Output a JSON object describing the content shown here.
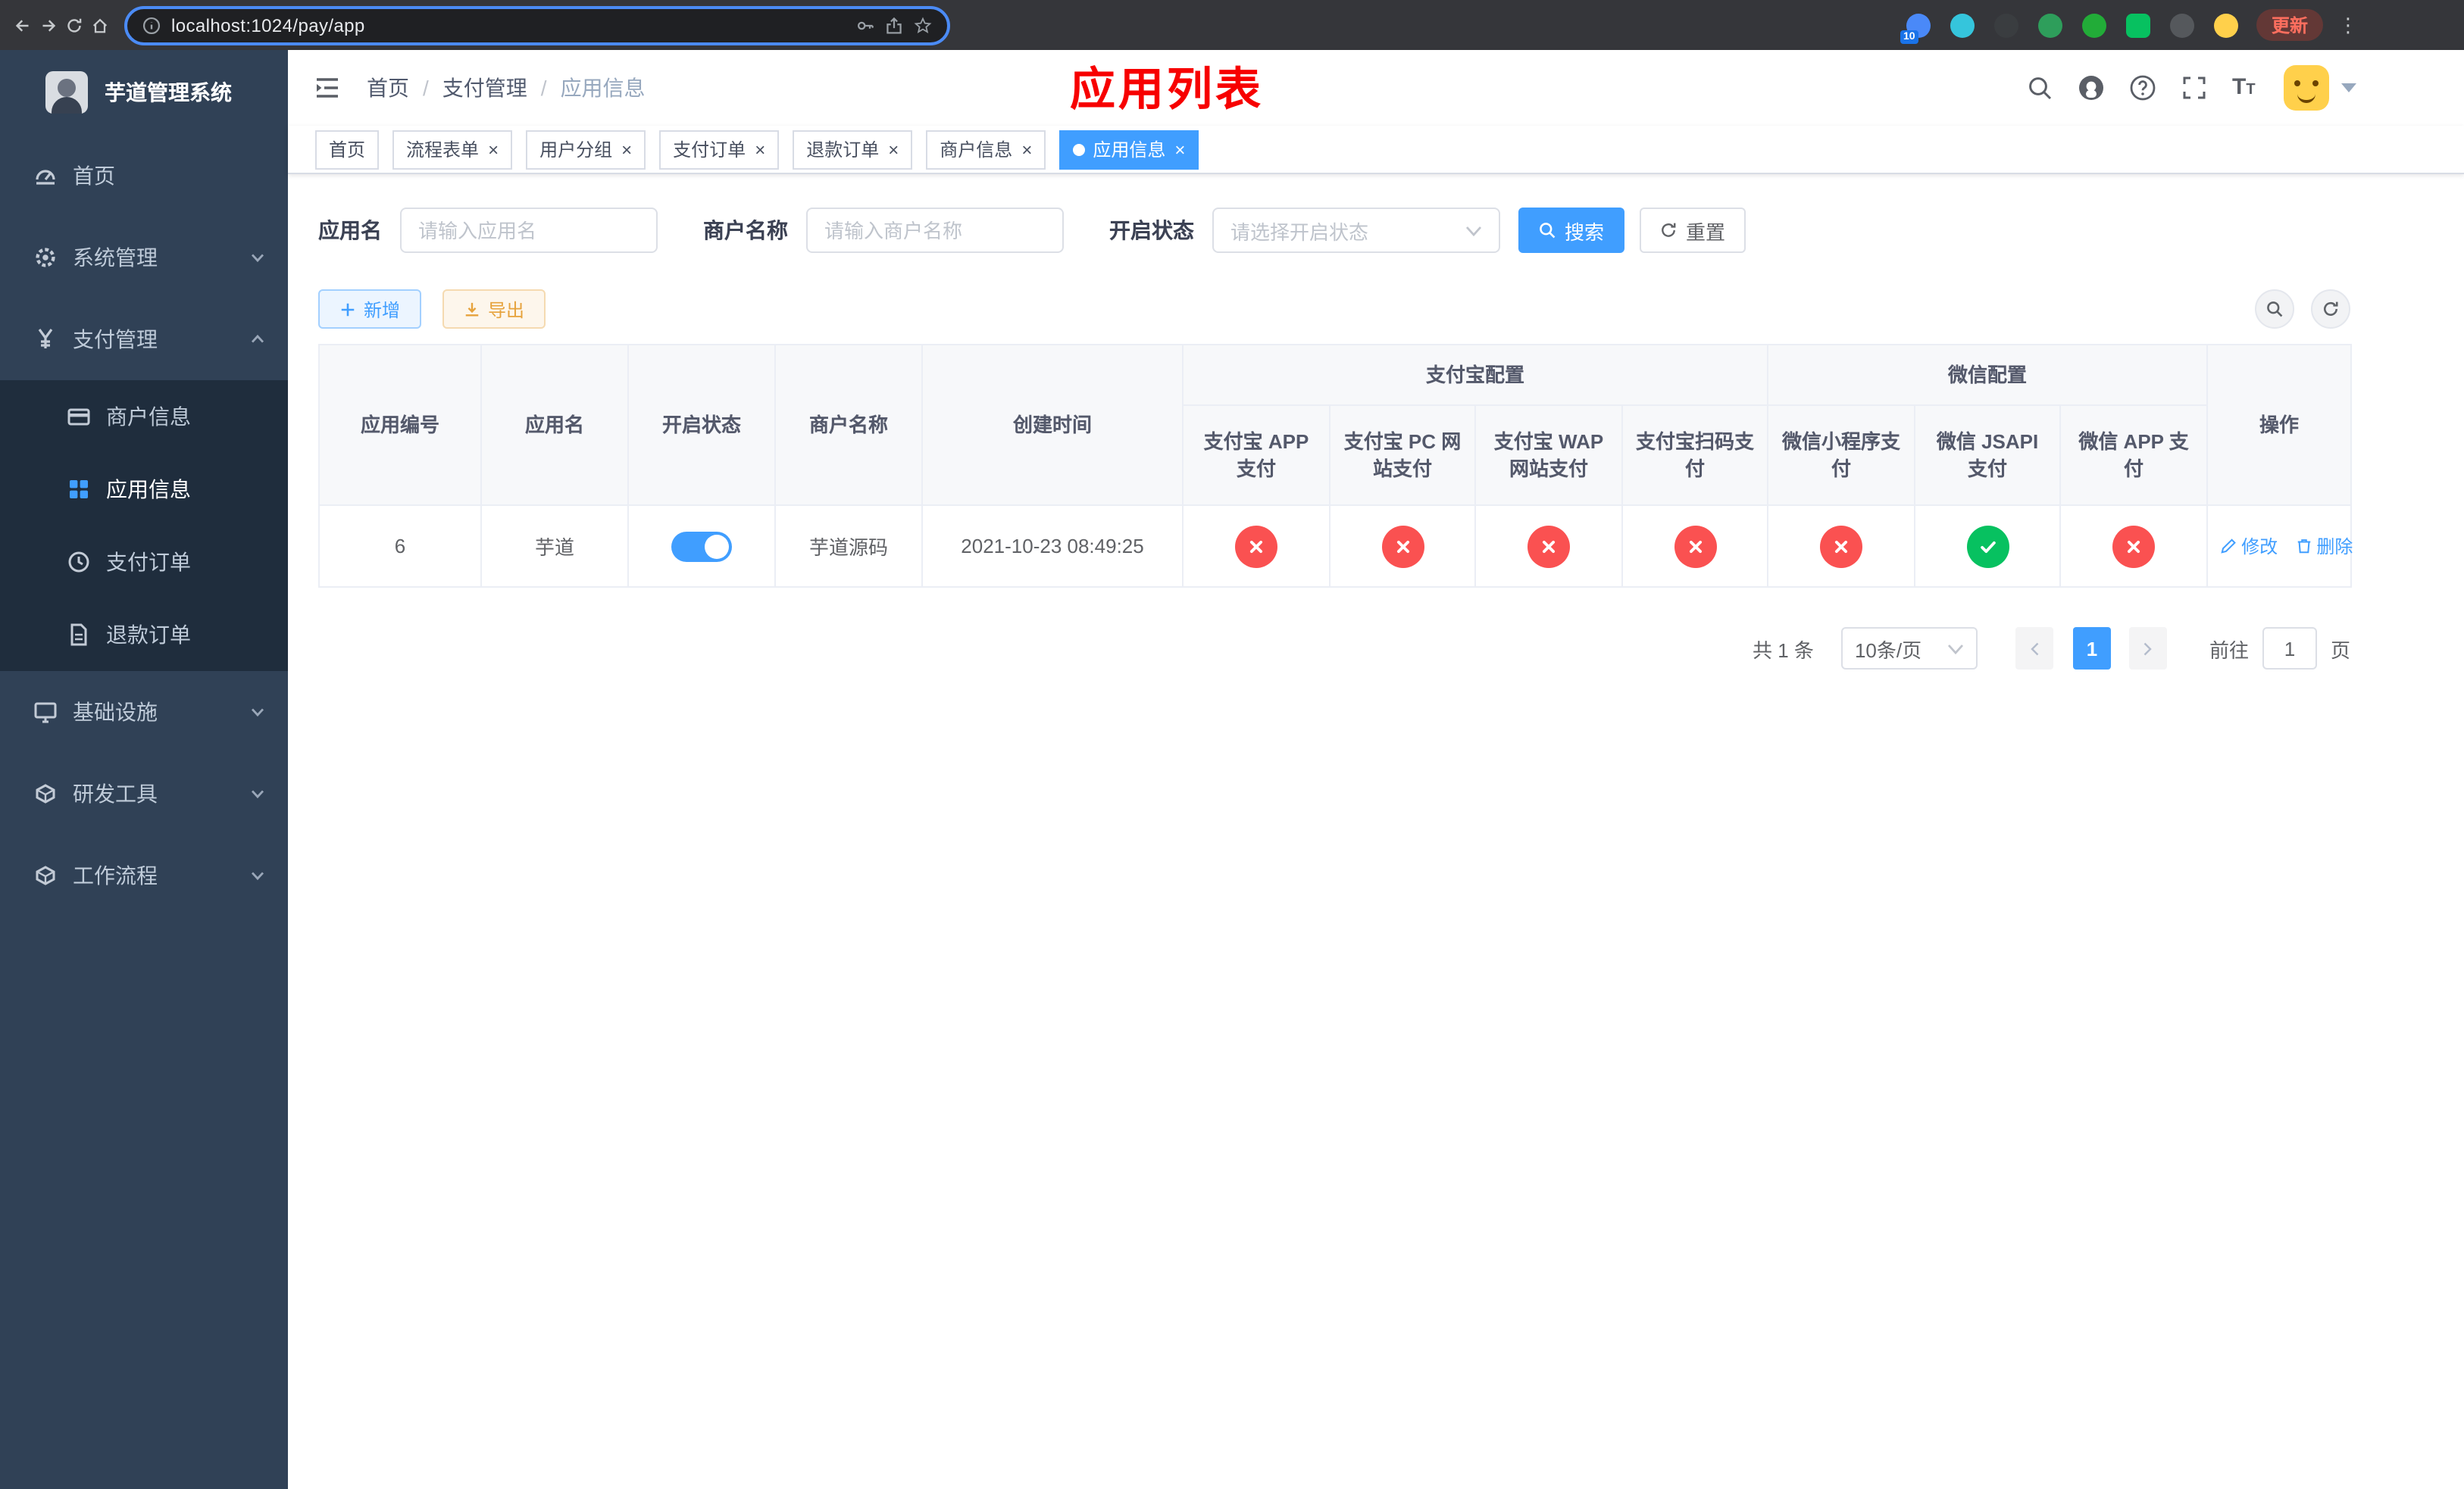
{
  "browser": {
    "url": "localhost:1024/pay/app",
    "update_label": "更新",
    "extensions": [
      {
        "name": "ext-blue-badge-icon",
        "color": "#4a89f8",
        "badge": "10"
      },
      {
        "name": "ext-diamond-icon",
        "color": "#35c5dc"
      },
      {
        "name": "ext-dark-globe-icon",
        "color": "#3a3d40"
      },
      {
        "name": "ext-green-leaf-icon",
        "color": "#2e9e5b"
      },
      {
        "name": "ext-green-circle-icon",
        "color": "#22ac38"
      },
      {
        "name": "ext-green-chat-icon",
        "color": "#07c160"
      },
      {
        "name": "ext-pin-icon",
        "color": "#55585c"
      },
      {
        "name": "ext-emoji-icon",
        "color": "#ffd04b"
      }
    ]
  },
  "sidebar": {
    "title": "芋道管理系统",
    "menu": [
      {
        "name": "home",
        "label": "首页",
        "icon": "dashboard",
        "level": "top"
      },
      {
        "name": "system",
        "label": "系统管理",
        "icon": "gear",
        "level": "top",
        "chevron": "down"
      },
      {
        "name": "payment",
        "label": "支付管理",
        "icon": "yen",
        "level": "top",
        "chevron": "up"
      },
      {
        "name": "merchant-info",
        "label": "商户信息",
        "icon": "card",
        "level": "sub"
      },
      {
        "name": "app-info",
        "label": "应用信息",
        "icon": "grid",
        "level": "sub",
        "active": true
      },
      {
        "name": "payment-order",
        "label": "支付订单",
        "icon": "clock",
        "level": "sub"
      },
      {
        "name": "refund-order",
        "label": "退款订单",
        "icon": "doc",
        "level": "sub"
      },
      {
        "name": "infrastructure",
        "label": "基础设施",
        "icon": "monitor",
        "level": "top",
        "chevron": "down"
      },
      {
        "name": "dev-tools",
        "label": "研发工具",
        "icon": "box",
        "level": "top",
        "chevron": "down"
      },
      {
        "name": "workflow",
        "label": "工作流程",
        "icon": "box",
        "level": "top",
        "chevron": "down"
      }
    ]
  },
  "header": {
    "breadcrumb": [
      "首页",
      "支付管理",
      "应用信息"
    ],
    "annotation": "应用列表"
  },
  "tabs": [
    {
      "name": "home",
      "label": "首页",
      "closable": false,
      "active": false
    },
    {
      "name": "flow-form",
      "label": "流程表单",
      "closable": true,
      "active": false
    },
    {
      "name": "user-group",
      "label": "用户分组",
      "closable": true,
      "active": false
    },
    {
      "name": "pay-order",
      "label": "支付订单",
      "closable": true,
      "active": false
    },
    {
      "name": "refund-order",
      "label": "退款订单",
      "closable": true,
      "active": false
    },
    {
      "name": "merchant-info",
      "label": "商户信息",
      "closable": true,
      "active": false
    },
    {
      "name": "app-info",
      "label": "应用信息",
      "closable": true,
      "active": true
    }
  ],
  "filters": {
    "app_name": {
      "label": "应用名",
      "placeholder": "请输入应用名",
      "value": ""
    },
    "merchant_name": {
      "label": "商户名称",
      "placeholder": "请输入商户名称",
      "value": ""
    },
    "status": {
      "label": "开启状态",
      "placeholder": "请选择开启状态",
      "value": ""
    },
    "search_label": "搜索",
    "reset_label": "重置"
  },
  "toolbar": {
    "add_label": "新增",
    "export_label": "导出"
  },
  "table": {
    "columns_left": [
      "应用编号",
      "应用名",
      "开启状态",
      "商户名称",
      "创建时间"
    ],
    "group_alipay": "支付宝配置",
    "group_wechat": "微信配置",
    "alipay_columns": [
      "支付宝 APP 支付",
      "支付宝 PC 网站支付",
      "支付宝 WAP 网站支付",
      "支付宝扫码支付"
    ],
    "wechat_columns": [
      "微信小程序支付",
      "微信 JSAPI 支付",
      "微信 APP 支付"
    ],
    "op_column": "操作",
    "rows": [
      {
        "id": "6",
        "name": "芋道",
        "enabled": true,
        "merchant": "芋道源码",
        "created": "2021-10-23 08:49:25",
        "statuses": [
          "fail",
          "fail",
          "fail",
          "fail",
          "fail",
          "success",
          "fail"
        ],
        "modify_label": "修改",
        "delete_label": "删除"
      }
    ]
  },
  "pagination": {
    "total": "共 1 条",
    "page_size": "10条/页",
    "page": "1",
    "goto_label": "前往",
    "goto_value": "1",
    "page_suffix": "页"
  },
  "colors": {
    "primary": "#409eff",
    "success": "#07c160",
    "danger": "#fa5151",
    "sidebar_bg": "#304156",
    "submenu_bg": "#1f2d3d",
    "annotation_red": "#f70000"
  }
}
